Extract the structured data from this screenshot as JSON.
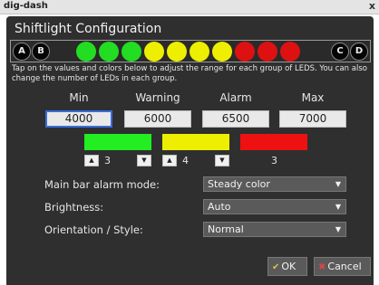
{
  "window": {
    "title": "dig-dash",
    "close_glyph": "x"
  },
  "heading": "Shiftlight Configuration",
  "led_bar": {
    "left_caps": [
      "A",
      "B"
    ],
    "right_caps": [
      "C",
      "D"
    ],
    "leds": [
      "#22dd22",
      "#22dd22",
      "#22dd22",
      "#eeee00",
      "#eeee00",
      "#eeee00",
      "#eeee00",
      "#dd1111",
      "#dd1111",
      "#dd1111"
    ]
  },
  "description": "Tap on the values and colors below to adjust the range for each group of LEDS. You can also change the number of LEDs in each group.",
  "columns": [
    {
      "label": "Min",
      "value": "4000"
    },
    {
      "label": "Warning",
      "value": "6000"
    },
    {
      "label": "Alarm",
      "value": "6500"
    },
    {
      "label": "Max",
      "value": "7000"
    }
  ],
  "groups": [
    {
      "color": "#22ee22",
      "count": "3"
    },
    {
      "color": "#eeee00",
      "count": "4"
    },
    {
      "color": "#ee1111",
      "count": "3"
    }
  ],
  "settings": [
    {
      "label": "Main bar alarm mode:",
      "value": "Steady color"
    },
    {
      "label": "Brightness:",
      "value": "Auto"
    },
    {
      "label": "Orientation / Style:",
      "value": "Normal"
    }
  ],
  "buttons": {
    "ok": "OK",
    "cancel": "Cancel"
  },
  "glyphs": {
    "up": "▲",
    "down": "▼",
    "caret": "▼",
    "ok_icon": "✔",
    "cancel_icon": "✖"
  },
  "icons": {
    "ok": "checkmark-icon",
    "cancel": "cross-icon",
    "spin_up": "arrow-up-icon",
    "spin_down": "arrow-down-icon"
  },
  "colors": {
    "panel_bg": "#2f2f2f",
    "focus_border": "#3a6dd8",
    "ok_icon": "#d8c44a",
    "cancel_icon": "#d44"
  }
}
